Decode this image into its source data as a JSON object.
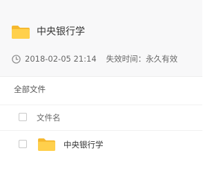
{
  "header": {
    "folder_icon": "folder-icon",
    "title": "中央银行学",
    "date": "2018-02-05 21:14",
    "expiry": "失效时间：永久有效",
    "clock_icon": "clock-icon"
  },
  "breadcrumb": {
    "label": "全部文件"
  },
  "file_list": {
    "header": {
      "name_label": "文件名"
    },
    "rows": [
      {
        "name": "中央银行学",
        "icon": "folder-icon"
      }
    ]
  },
  "colors": {
    "folder": "#f9c23c",
    "header_bg": "#f8f8f9",
    "text_main": "#333333",
    "text_muted": "#666666"
  }
}
